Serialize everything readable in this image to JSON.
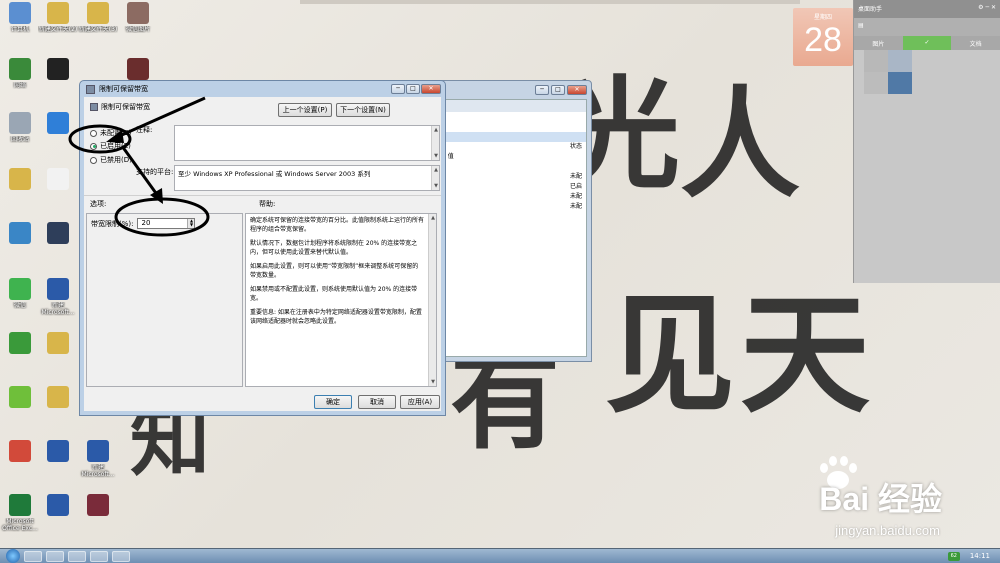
{
  "desktop": {
    "icons": [
      {
        "label": "计算机",
        "color": "#5b8fd1"
      },
      {
        "label": "新建文件夹(2)",
        "color": "#d8b54a"
      },
      {
        "label": "新建文件夹(3)",
        "color": "#d8b54a"
      },
      {
        "label": "微信图片",
        "color": "#8c6b62"
      },
      {
        "label": "网络",
        "color": "#3a8a3a"
      },
      {
        "label": "",
        "color": "#222222"
      },
      {
        "label": "",
        "color": "#6a2d2d"
      },
      {
        "label": "回收站",
        "color": "#9aa6b4"
      },
      {
        "label": "",
        "color": "#2f7fd8"
      },
      {
        "label": "",
        "color": "#d8b54a"
      },
      {
        "label": "",
        "color": "#f2f2f2"
      },
      {
        "label": "",
        "color": "#3a86c6"
      },
      {
        "label": "",
        "color": "#2e3e5a"
      },
      {
        "label": "微信",
        "color": "#3fb34f"
      },
      {
        "label": "新建 Microsoft...",
        "color": "#2b5aa8"
      },
      {
        "label": "",
        "color": "#3a9a3a"
      },
      {
        "label": "",
        "color": "#d8b54a"
      },
      {
        "label": "",
        "color": "#6fbf3a"
      },
      {
        "label": "",
        "color": "#d8b54a"
      },
      {
        "label": "",
        "color": "#d24a3a"
      },
      {
        "label": "",
        "color": "#2b5aa8"
      },
      {
        "label": "新建 Microsoft...",
        "color": "#2b5aa8"
      },
      {
        "label": "Microsoft Office Exc...",
        "color": "#1f7a3a"
      },
      {
        "label": "",
        "color": "#2b5aa8"
      },
      {
        "label": "",
        "color": "#7a2b3a"
      }
    ]
  },
  "wallpaper": {
    "chars": [
      "光",
      "人",
      "见",
      "有",
      "天",
      "知"
    ],
    "watermark": "Bai 经验",
    "watermark_sub": "jingyan.baidu.com"
  },
  "calendar": {
    "month": "星期四",
    "day": "28"
  },
  "side_panel": {
    "title": "桌面助手",
    "tab_photos": "图片",
    "tab_docs": "文档"
  },
  "back_window": {
    "lines": [
      {
        "left": "CP 值",
        "right": ""
      },
      {
        "left": "值",
        "right": ""
      },
      {
        "left": "",
        "right": "未配"
      },
      {
        "left": "",
        "right": "已启"
      },
      {
        "left": "",
        "right": "未配"
      },
      {
        "left": "",
        "right": "未配"
      }
    ],
    "state_col": "状态"
  },
  "dialog": {
    "title": "限制可保留带宽",
    "policy_name": "限制可保留带宽",
    "prev_btn": "上一个设置(P)",
    "next_btn": "下一个设置(N)",
    "radio_not_configured": "未配置(C)",
    "radio_enabled": "已启用(E)",
    "radio_disabled": "已禁用(D)",
    "comment_label": "注释:",
    "supported_label": "支持的平台:",
    "supported_value": "至少 Windows XP Professional 或 Windows Server 2003 系列",
    "options_label": "选项:",
    "help_label": "帮助:",
    "bandwidth_label": "带宽限制(%):",
    "bandwidth_value": "20",
    "help_paragraphs": [
      "确定系统可保留的连接带宽的百分比。此值限制系统上运行的所有程序的组合带宽保留。",
      "默认情况下，数据包计划程序将系统限制在 20% 的连接带宽之内，但可以使用此设置来替代默认值。",
      "如果启用此设置，则可以使用“带宽限制”框来调整系统可保留的带宽数量。",
      "如果禁用或不配置此设置，则系统使用默认值为 20% 的连接带宽。",
      "重要信息: 如果在注册表中为特定网络适配器设置带宽限制，配置该网络适配器时就会忽略此设置。"
    ],
    "ok_btn": "确定",
    "cancel_btn": "取消",
    "apply_btn": "应用(A)"
  },
  "taskbar": {
    "tray_badge": "62",
    "clock": "14:11"
  }
}
